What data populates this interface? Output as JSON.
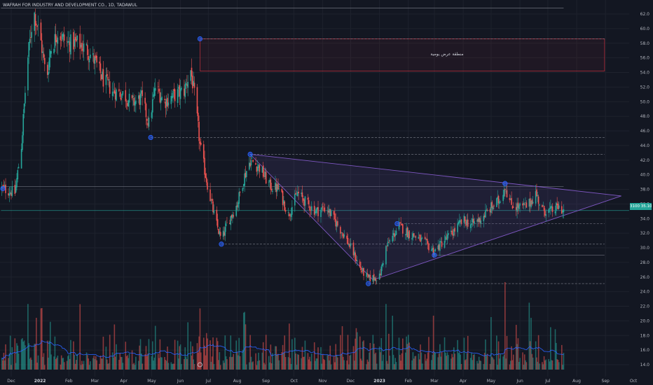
{
  "header": {
    "title": "WAFRAH FOR INDUSTRY AND DEVELOPMENT CO., 1D, TADAWUL"
  },
  "price_badge": {
    "label": "3100",
    "value": "35.10",
    "text": "3100 35.10"
  },
  "zone": {
    "label": "منطقة عرض يومية",
    "top": 58.6,
    "bottom": 54.2
  },
  "colors": {
    "up": "#26a69a",
    "down": "#ef5350",
    "background": "#131722",
    "triangle": "#7e57c2",
    "zone": "#f23645",
    "volume_ma": "#2962ff"
  },
  "chart_data": {
    "type": "candlestick",
    "title": "WAFRAH FOR INDUSTRY AND DEVELOPMENT CO., 1D, TADAWUL",
    "xlabel": "",
    "ylabel": "",
    "ylim": [
      13,
      64
    ],
    "y_ticks": [
      "62.0",
      "60.0",
      "58.0",
      "56.0",
      "54.0",
      "52.0",
      "50.0",
      "48.0",
      "46.0",
      "44.0",
      "42.0",
      "40.0",
      "38.0",
      "36.0",
      "34.0",
      "32.0",
      "30.0",
      "28.0",
      "26.0",
      "24.0",
      "22.0",
      "20.0",
      "18.0",
      "16.0",
      "14.0"
    ],
    "x_ticks": [
      {
        "label": "Dec",
        "date": "2021-12-01",
        "bold": false
      },
      {
        "label": "2022",
        "date": "2022-01-01",
        "bold": true
      },
      {
        "label": "Feb",
        "date": "2022-02-01",
        "bold": false
      },
      {
        "label": "Mar",
        "date": "2022-03-01",
        "bold": false
      },
      {
        "label": "Apr",
        "date": "2022-04-01",
        "bold": false
      },
      {
        "label": "May",
        "date": "2022-05-01",
        "bold": false
      },
      {
        "label": "Jun",
        "date": "2022-06-01",
        "bold": false
      },
      {
        "label": "Jul",
        "date": "2022-07-01",
        "bold": false
      },
      {
        "label": "Aug",
        "date": "2022-08-01",
        "bold": false
      },
      {
        "label": "Sep",
        "date": "2022-09-01",
        "bold": false
      },
      {
        "label": "Oct",
        "date": "2022-10-01",
        "bold": false
      },
      {
        "label": "Nov",
        "date": "2022-11-01",
        "bold": false
      },
      {
        "label": "Dec",
        "date": "2022-12-01",
        "bold": false
      },
      {
        "label": "2023",
        "date": "2023-01-01",
        "bold": true
      },
      {
        "label": "Feb",
        "date": "2023-02-01",
        "bold": false
      },
      {
        "label": "Mar",
        "date": "2023-03-01",
        "bold": false
      },
      {
        "label": "Apr",
        "date": "2023-04-01",
        "bold": false
      },
      {
        "label": "May",
        "date": "2023-05-01",
        "bold": false
      },
      {
        "label": "Jun",
        "date": "2023-06-01",
        "bold": false
      },
      {
        "label": "Jul",
        "date": "2023-07-01",
        "bold": false
      },
      {
        "label": "Aug",
        "date": "2023-08-01",
        "bold": false
      },
      {
        "label": "Sep",
        "date": "2023-09-01",
        "bold": false
      },
      {
        "label": "Oct",
        "date": "2023-10-01",
        "bold": false
      }
    ],
    "price_path": [
      [
        "2021-11-20",
        38.2
      ],
      [
        "2021-12-05",
        37.5
      ],
      [
        "2021-12-12",
        44
      ],
      [
        "2021-12-18",
        55
      ],
      [
        "2021-12-25",
        62.5
      ],
      [
        "2022-01-01",
        59
      ],
      [
        "2022-01-08",
        53
      ],
      [
        "2022-01-12",
        57
      ],
      [
        "2022-01-20",
        59.5
      ],
      [
        "2022-01-30",
        58
      ],
      [
        "2022-02-10",
        58
      ],
      [
        "2022-02-20",
        57.2
      ],
      [
        "2022-03-01",
        55.5
      ],
      [
        "2022-03-10",
        53
      ],
      [
        "2022-03-20",
        51.5
      ],
      [
        "2022-04-01",
        51
      ],
      [
        "2022-04-10",
        49.8
      ],
      [
        "2022-04-20",
        50.5
      ],
      [
        "2022-04-28",
        47
      ],
      [
        "2022-05-05",
        52
      ],
      [
        "2022-05-15",
        50
      ],
      [
        "2022-05-25",
        50.8
      ],
      [
        "2022-06-05",
        51.5
      ],
      [
        "2022-06-12",
        54.3
      ],
      [
        "2022-06-17",
        50
      ],
      [
        "2022-06-22",
        44
      ],
      [
        "2022-07-01",
        38
      ],
      [
        "2022-07-08",
        34
      ],
      [
        "2022-07-15",
        31
      ],
      [
        "2022-07-22",
        33.5
      ],
      [
        "2022-08-01",
        36
      ],
      [
        "2022-08-08",
        39.5
      ],
      [
        "2022-08-15",
        42
      ],
      [
        "2022-08-25",
        41
      ],
      [
        "2022-09-05",
        38.5
      ],
      [
        "2022-09-15",
        38
      ],
      [
        "2022-09-25",
        34.5
      ],
      [
        "2022-10-05",
        37.5
      ],
      [
        "2022-10-15",
        36
      ],
      [
        "2022-10-25",
        35
      ],
      [
        "2022-11-05",
        35.5
      ],
      [
        "2022-11-15",
        33.5
      ],
      [
        "2022-11-25",
        31.5
      ],
      [
        "2022-12-05",
        29
      ],
      [
        "2022-12-12",
        27
      ],
      [
        "2022-12-20",
        25.8
      ],
      [
        "2023-01-01",
        26
      ],
      [
        "2023-01-08",
        30
      ],
      [
        "2023-01-15",
        31.5
      ],
      [
        "2023-01-22",
        33
      ],
      [
        "2023-02-01",
        32
      ],
      [
        "2023-02-10",
        31.5
      ],
      [
        "2023-02-20",
        30.5
      ],
      [
        "2023-03-01",
        29.5
      ],
      [
        "2023-03-10",
        30.8
      ],
      [
        "2023-03-20",
        32
      ],
      [
        "2023-04-01",
        33.8
      ],
      [
        "2023-04-10",
        33.2
      ],
      [
        "2023-04-20",
        34
      ],
      [
        "2023-05-01",
        35.5
      ],
      [
        "2023-05-10",
        36.5
      ],
      [
        "2023-05-16",
        38.5
      ],
      [
        "2023-05-22",
        36
      ],
      [
        "2023-06-01",
        35.5
      ],
      [
        "2023-06-10",
        35.8
      ],
      [
        "2023-06-18",
        37.5
      ],
      [
        "2023-06-25",
        35.2
      ],
      [
        "2023-07-05",
        35
      ],
      [
        "2023-07-12",
        35.6
      ],
      [
        "2023-07-18",
        35.1
      ]
    ],
    "volume_ylim": [
      0,
      40
    ],
    "horizontal_levels": [
      {
        "value": 62.8,
        "from": "2021-11-20",
        "to": "2023-07-18",
        "style": "solid"
      },
      {
        "value": 58.6,
        "from": "2022-06-22",
        "to": "2023-08-31",
        "style": "dashed"
      },
      {
        "value": 45.1,
        "from": "2022-04-30",
        "to": "2023-08-31",
        "style": "dashed"
      },
      {
        "value": 42.8,
        "from": "2022-08-15",
        "to": "2023-08-31",
        "style": "dashed"
      },
      {
        "value": 38.4,
        "from": "2021-11-20",
        "to": "2023-07-18",
        "style": "solid"
      },
      {
        "value": 35.1,
        "from": "2021-11-20",
        "to": "2023-10-20",
        "style": "solid"
      },
      {
        "value": 33.3,
        "from": "2023-01-20",
        "to": "2023-08-31",
        "style": "dashed"
      },
      {
        "value": 30.5,
        "from": "2022-07-15",
        "to": "2023-08-31",
        "style": "dashed"
      },
      {
        "value": 29.0,
        "from": "2023-03-01",
        "to": "2023-08-31",
        "style": "solid"
      },
      {
        "value": 25.1,
        "from": "2022-12-20",
        "to": "2023-08-31",
        "style": "dashed"
      }
    ],
    "pivot_points": [
      {
        "date": "2021-11-22",
        "value": 38.1
      },
      {
        "date": "2022-04-30",
        "value": 45.1
      },
      {
        "date": "2022-06-22",
        "value": 58.6
      },
      {
        "date": "2022-07-15",
        "value": 30.5
      },
      {
        "date": "2022-08-15",
        "value": 42.8
      },
      {
        "date": "2022-12-20",
        "value": 25.1
      },
      {
        "date": "2023-01-20",
        "value": 33.3
      },
      {
        "date": "2023-03-01",
        "value": 29.0
      },
      {
        "date": "2023-05-16",
        "value": 38.8
      }
    ],
    "triangle": [
      {
        "date": "2022-08-15",
        "value": 42.8
      },
      {
        "date": "2023-09-18",
        "value": 37.1
      },
      {
        "date": "2022-12-25",
        "value": 25.6
      }
    ],
    "zone_box": {
      "from": "2022-06-22",
      "to": "2023-08-31",
      "top": 58.6,
      "bottom": 54.2
    },
    "last_price": 35.1,
    "y_tick_values": [
      62,
      60,
      58,
      56,
      54,
      52,
      50,
      48,
      46,
      44,
      42,
      40,
      38,
      36,
      34,
      32,
      30,
      28,
      26,
      24,
      22,
      20,
      18,
      16,
      14
    ]
  }
}
